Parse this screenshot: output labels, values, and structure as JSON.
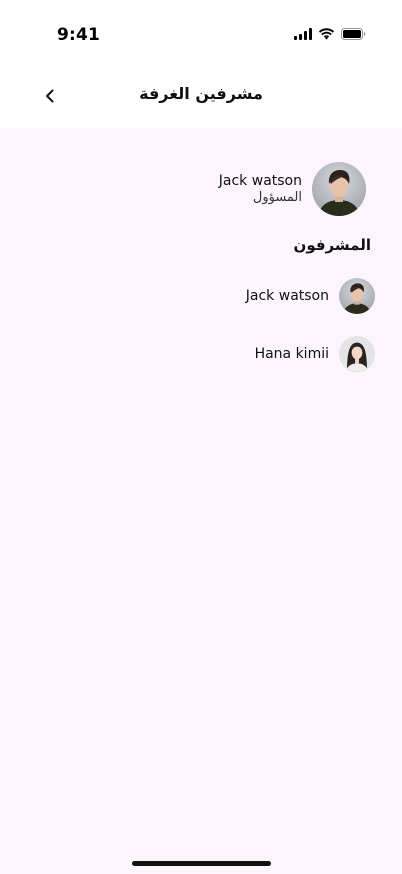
{
  "status_bar": {
    "time": "9:41"
  },
  "header": {
    "title": "مشرفين الغرفة",
    "back_icon": "chevron-left-icon"
  },
  "owner": {
    "name": "Jack watson",
    "role": "المسؤول",
    "avatar": "male-avatar"
  },
  "moderators": {
    "section_title": "المشرفون",
    "items": [
      {
        "name": "Jack watson",
        "avatar": "male-avatar"
      },
      {
        "name": "Hana kimii",
        "avatar": "female-avatar"
      }
    ]
  },
  "colors": {
    "background": "#fdf5fd",
    "header_bg": "#ffffff",
    "text": "#111111"
  }
}
